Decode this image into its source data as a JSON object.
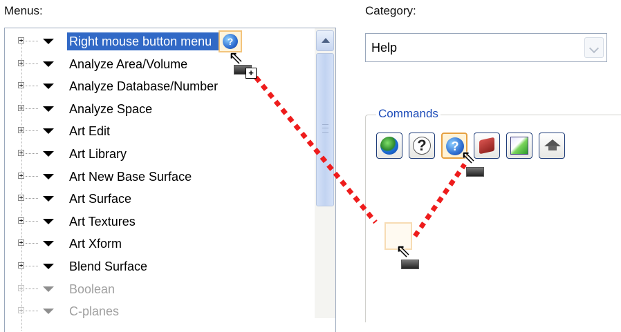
{
  "labels": {
    "menus": "Menus:",
    "category": "Category:",
    "commands": "Commands"
  },
  "tree": {
    "items": [
      {
        "label": "Right mouse button menu",
        "selected": true
      },
      {
        "label": "Analyze Area/Volume"
      },
      {
        "label": "Analyze Database/Number"
      },
      {
        "label": "Analyze Space"
      },
      {
        "label": "Art Edit"
      },
      {
        "label": "Art Library"
      },
      {
        "label": "Art New Base Surface"
      },
      {
        "label": "Art Surface"
      },
      {
        "label": "Art Textures"
      },
      {
        "label": "Art Xform"
      },
      {
        "label": "Blend Surface"
      },
      {
        "label": "Boolean",
        "faded": true
      },
      {
        "label": "C-planes",
        "faded": true
      }
    ]
  },
  "category_combo": {
    "value": "Help"
  },
  "command_buttons": [
    {
      "name": "globe-icon",
      "glyph": ""
    },
    {
      "name": "whats-this-help-icon",
      "glyph": "?"
    },
    {
      "name": "help-icon",
      "glyph": "?"
    },
    {
      "name": "book-icon",
      "glyph": ""
    },
    {
      "name": "wizard-icon",
      "glyph": ""
    },
    {
      "name": "graduation-cap-icon",
      "glyph": ""
    }
  ],
  "drag_indicator": {
    "plus_glyph": "+",
    "cursor_glyph": "⇖",
    "help_glyph": "?",
    "path_color": "#ee1c1c"
  },
  "colors": {
    "selection": "#3169c6",
    "hot_border": "#e6a040",
    "legend": "#1c4bb8"
  }
}
